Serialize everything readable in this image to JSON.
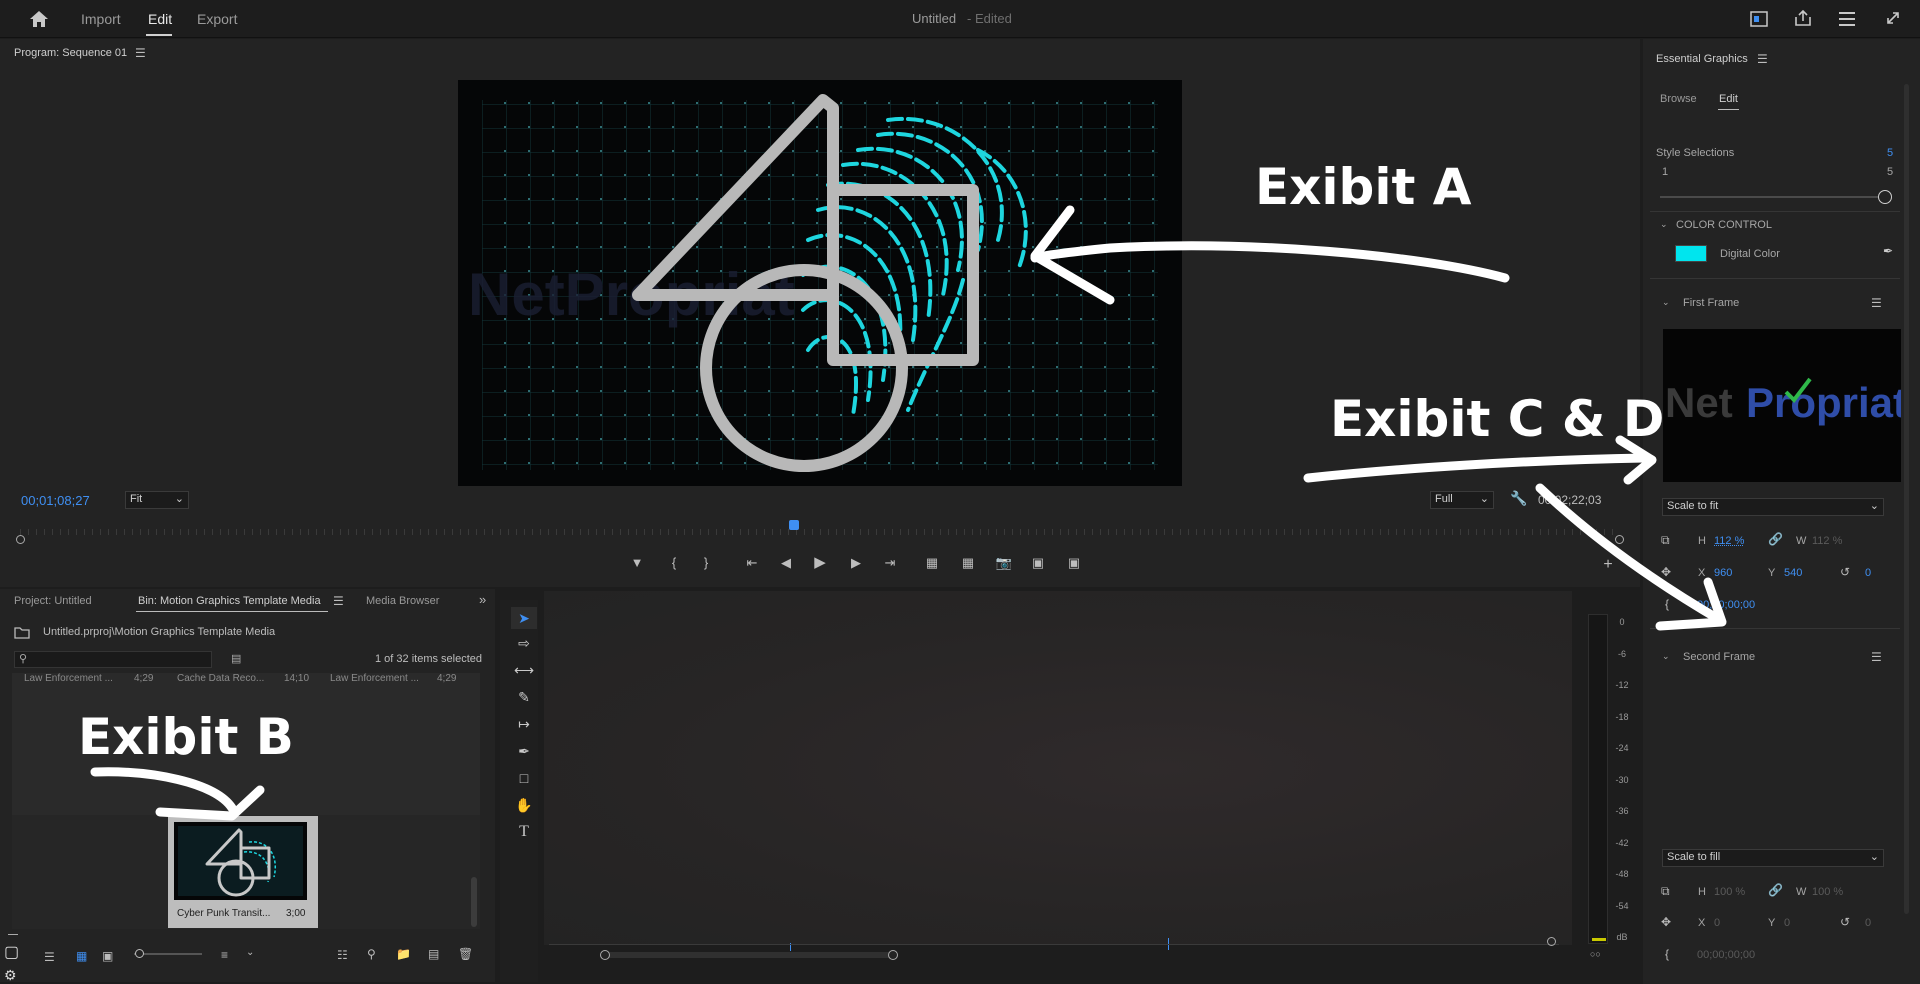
{
  "topbar": {
    "tabs": [
      {
        "label": "Import"
      },
      {
        "label": "Edit"
      },
      {
        "label": "Export"
      }
    ],
    "doc_title": "Untitled",
    "doc_status": "- Edited"
  },
  "program_monitor": {
    "title": "Program: Sequence 01",
    "timecode": "00;01;08;27",
    "zoom": "Fit",
    "resolution": "Full",
    "duration": "00;02;22;03"
  },
  "project_panel": {
    "tabs": [
      {
        "label": "Project: Untitled"
      },
      {
        "label": "Bin: Motion Graphics Template Media"
      },
      {
        "label": "Media Browser"
      }
    ],
    "path": "Untitled.prproj\\Motion Graphics Template Media",
    "selection_count": "1 of 32 items selected",
    "row_items": [
      {
        "name": "Law Enforcement ...",
        "duration": "4;29"
      },
      {
        "name": "Cache Data Reco...",
        "duration": "14;10"
      },
      {
        "name": "Law Enforcement ...",
        "duration": "4;29"
      }
    ],
    "clip": {
      "name": "Cyber Punk Transit...",
      "duration": "3;00"
    }
  },
  "audio_meter": {
    "labels": [
      "0",
      "-6",
      "-12",
      "-18",
      "-24",
      "-30",
      "-36",
      "-42",
      "-48",
      "-54",
      "dB"
    ]
  },
  "essential_graphics": {
    "title": "Essential Graphics",
    "tabs": [
      {
        "label": "Browse"
      },
      {
        "label": "Edit"
      }
    ],
    "style_selections_label": "Style Selections",
    "style_selections_value": "5",
    "slider_min": "1",
    "slider_max": "5",
    "color_control_label": "COLOR CONTROL",
    "digital_color_label": "Digital Color",
    "digital_color_hex": "#00e5ee",
    "first_frame": {
      "label": "First Frame",
      "thumb_text_a": "Net",
      "thumb_text_b": "Propriat",
      "scale_mode": "Scale to fit",
      "h_label": "H",
      "h_value": "112 %",
      "w_label": "W",
      "w_value": "112 %",
      "x_label": "X",
      "x_value": "960",
      "y_label": "Y",
      "y_value": "540",
      "rotation": "0",
      "timecode": "00;00;00;00"
    },
    "second_frame": {
      "label": "Second Frame",
      "scale_mode": "Scale to fill",
      "h_label": "H",
      "h_value": "100 %",
      "w_label": "W",
      "w_value": "100 %",
      "x_label": "X",
      "x_value": "0",
      "y_label": "Y",
      "y_value": "0",
      "rotation": "0",
      "timecode": "00;00;00;00"
    }
  },
  "annotations": {
    "a": "Exibit A",
    "b": "Exibit B",
    "cd": "Exibit C & D"
  }
}
